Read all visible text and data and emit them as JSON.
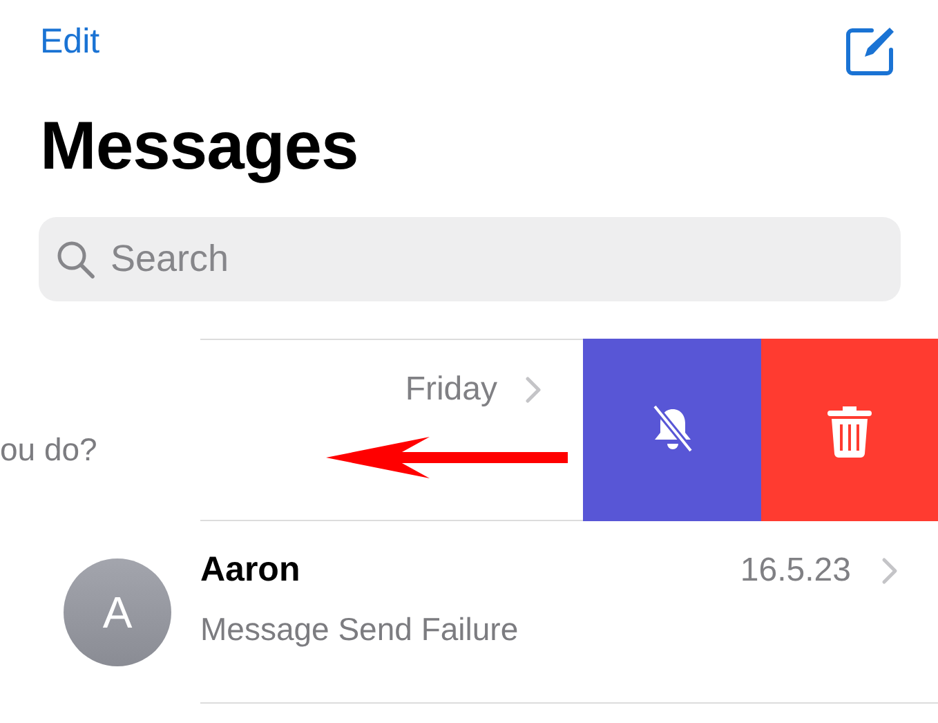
{
  "nav": {
    "edit": "Edit"
  },
  "title": "Messages",
  "search": {
    "placeholder": "Search"
  },
  "conversations": [
    {
      "kind": "swiped",
      "date": "Friday",
      "preview": "ou do?",
      "actions": [
        {
          "kind": "mute"
        },
        {
          "kind": "delete"
        }
      ]
    },
    {
      "kind": "normal",
      "initial": "A",
      "name": "Aaron",
      "date": "16.5.23",
      "preview": "Message Send Failure"
    }
  ]
}
